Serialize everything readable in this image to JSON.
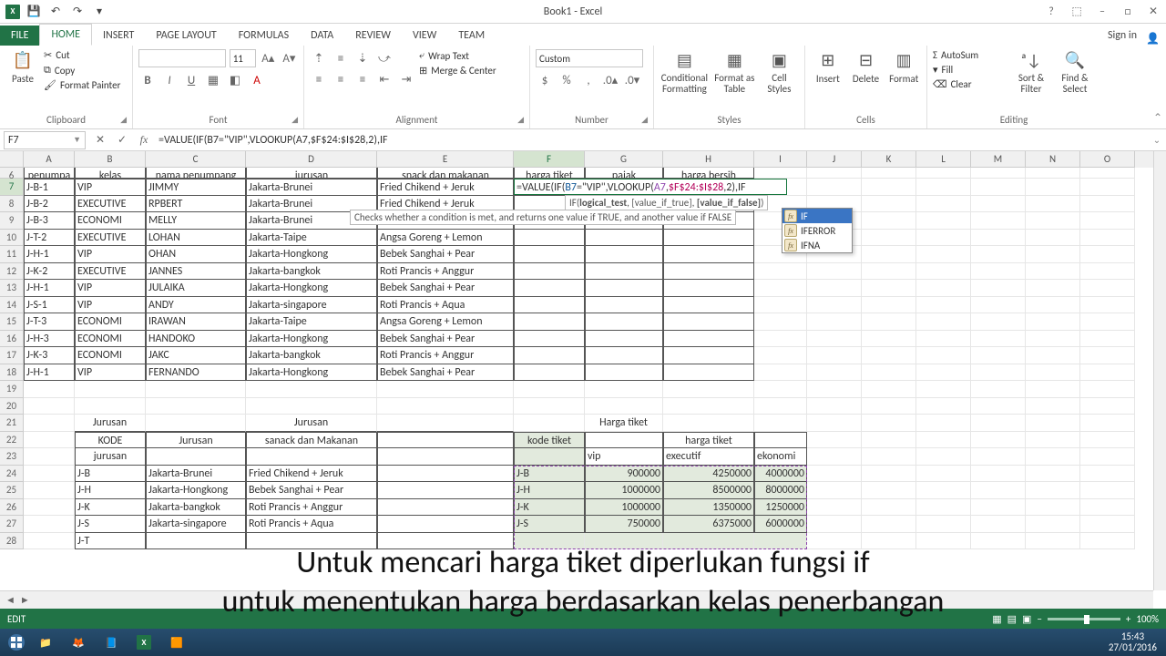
{
  "app": {
    "title": "Book1 - Excel"
  },
  "qat": {
    "save": "💾",
    "undo": "↶",
    "redo": "↷"
  },
  "wincontrols": {
    "help": "?",
    "full": "⬚",
    "min": "–",
    "max": "□",
    "close": "✕"
  },
  "tabs": {
    "file": "FILE",
    "home": "HOME",
    "insert": "INSERT",
    "page": "PAGE LAYOUT",
    "formulas": "FORMULAS",
    "data": "DATA",
    "review": "REVIEW",
    "view": "VIEW",
    "team": "TEAM",
    "signin": "Sign in"
  },
  "ribbon": {
    "clipboard": {
      "label": "Clipboard",
      "paste": "Paste",
      "cut": "Cut",
      "copy": "Copy",
      "fmtpaint": "Format Painter"
    },
    "font": {
      "label": "Font",
      "name": "",
      "size": "11"
    },
    "alignment": {
      "label": "Alignment",
      "wrap": "Wrap Text",
      "merge": "Merge & Center"
    },
    "number": {
      "label": "Number",
      "fmt": "Custom"
    },
    "styles": {
      "label": "Styles",
      "cond": "Conditional Formatting",
      "tbl": "Format as Table",
      "cell": "Cell Styles"
    },
    "cells": {
      "label": "Cells",
      "insert": "Insert",
      "delete": "Delete",
      "format": "Format"
    },
    "editing": {
      "label": "Editing",
      "sum": "AutoSum",
      "fill": "Fill",
      "clear": "Clear",
      "sort": "Sort & Filter",
      "find": "Find & Select"
    }
  },
  "namebox": "F7",
  "formula": "=VALUE(IF(B7=\"VIP\",VLOOKUP(A7,$F$24:$I$28,2),IF",
  "editcell": {
    "plain1": "=VALUE(IF(",
    "b": "B7",
    "plain2": "=\"VIP\",VLOOKUP(",
    "a": "A7",
    "plain3": ",",
    "r": "$F$24:$I$28",
    "plain4": ",2),IF"
  },
  "tooltip_syntax": "IF(logical_test, [value_if_true], [value_if_false])",
  "tooltip_desc": "Checks whether a condition is met, and returns one value if TRUE, and another value if FALSE",
  "autolist": {
    "items": [
      "IF",
      "IFERROR",
      "IFNA"
    ]
  },
  "columns": [
    "A",
    "B",
    "C",
    "D",
    "E",
    "F",
    "G",
    "H",
    "I",
    "J",
    "K",
    "L",
    "M",
    "N",
    "O"
  ],
  "headers6": {
    "A": "penumpa",
    "B": "kelas",
    "C": "nama penumpang",
    "D": "jurusan",
    "E": "snack dan makanan",
    "F": "harga tiket",
    "G": "pajak",
    "H": "harga bersih"
  },
  "main": [
    {
      "r": 7,
      "A": "J-B-1",
      "B": "VIP",
      "C": "JIMMY",
      "D": "Jakarta-Brunei",
      "E": "Fried Chikend + Jeruk"
    },
    {
      "r": 8,
      "A": "J-B-2",
      "B": "EXECUTIVE",
      "C": "RPBERT",
      "D": "Jakarta-Brunei",
      "E": "Fried Chikend + Jeruk"
    },
    {
      "r": 9,
      "A": "J-B-3",
      "B": "ECONOMI",
      "C": "MELLY",
      "D": "Jakarta-Brunei"
    },
    {
      "r": 10,
      "A": "J-T-2",
      "B": "EXECUTIVE",
      "C": "LOHAN",
      "D": "Jakarta-Taipe",
      "E": "Angsa Goreng + Lemon"
    },
    {
      "r": 11,
      "A": "J-H-1",
      "B": "VIP",
      "C": "OHAN",
      "D": "Jakarta-Hongkong",
      "E": "Bebek Sanghai + Pear"
    },
    {
      "r": 12,
      "A": "J-K-2",
      "B": "EXECUTIVE",
      "C": "JANNES",
      "D": "Jakarta-bangkok",
      "E": "Roti Prancis + Anggur"
    },
    {
      "r": 13,
      "A": "J-H-1",
      "B": "VIP",
      "C": "JULAIKA",
      "D": "Jakarta-Hongkong",
      "E": "Bebek Sanghai + Pear"
    },
    {
      "r": 14,
      "A": "J-S-1",
      "B": "VIP",
      "C": "ANDY",
      "D": "Jakarta-singapore",
      "E": "Roti Prancis + Aqua"
    },
    {
      "r": 15,
      "A": "J-T-3",
      "B": "ECONOMI",
      "C": "IRAWAN",
      "D": "Jakarta-Taipe",
      "E": "Angsa Goreng + Lemon"
    },
    {
      "r": 16,
      "A": "J-H-3",
      "B": "ECONOMI",
      "C": "HANDOKO",
      "D": "Jakarta-Hongkong",
      "E": "Bebek Sanghai + Pear"
    },
    {
      "r": 17,
      "A": "J-K-3",
      "B": "ECONOMI",
      "C": "JAKC",
      "D": "Jakarta-bangkok",
      "E": "Roti Prancis + Anggur"
    },
    {
      "r": 18,
      "A": "J-H-1",
      "B": "VIP",
      "C": "FERNANDO",
      "D": "Jakarta-Hongkong",
      "E": "Bebek Sanghai + Pear"
    }
  ],
  "lut1": {
    "title": "Jurusan",
    "h1": "KODE jurusan",
    "h2": "Jurusan",
    "h3": "sanack dan Makanan",
    "rows": [
      {
        "k": "J-B",
        "j": "Jakarta-Brunei",
        "s": "Fried Chikend + Jeruk"
      },
      {
        "k": "J-H",
        "j": "Jakarta-Hongkong",
        "s": "Bebek Sanghai + Pear"
      },
      {
        "k": "J-K",
        "j": "Jakarta-bangkok",
        "s": "Roti Prancis + Anggur"
      },
      {
        "k": "J-S",
        "j": "Jakarta-singapore",
        "s": "Roti Prancis + Aqua"
      },
      {
        "k": "J-T",
        "j": "",
        "s": ""
      }
    ]
  },
  "lut2": {
    "title": "Harga tiket",
    "h1": "kode tiket",
    "h2": "harga tiket",
    "c1": "vip",
    "c2": "executif",
    "c3": "ekonomi",
    "rows": [
      {
        "k": "J-B",
        "v": "900000",
        "e": "4250000",
        "o": "4000000"
      },
      {
        "k": "J-H",
        "v": "1000000",
        "e": "8500000",
        "o": "8000000"
      },
      {
        "k": "J-K",
        "v": "1000000",
        "e": "1350000",
        "o": "1250000"
      },
      {
        "k": "J-S",
        "v": "750000",
        "e": "6375000",
        "o": "6000000"
      }
    ]
  },
  "caption": {
    "l1": "Untuk mencari harga tiket diperlukan fungsi if",
    "l2": "untuk menentukan harga berdasarkan kelas penerbangan"
  },
  "status": {
    "mode": "EDIT",
    "zoom": "100%"
  },
  "clock": {
    "time": "15:43",
    "date": "27/01/2016"
  }
}
